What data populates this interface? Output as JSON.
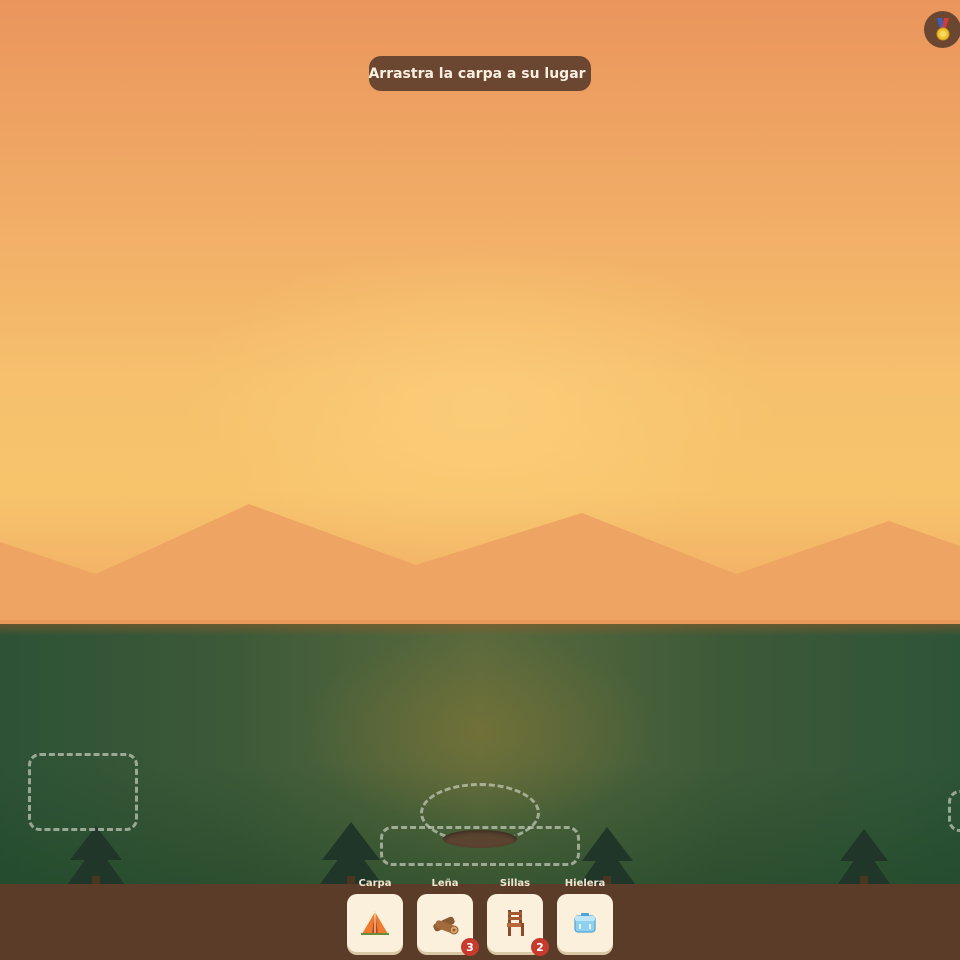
{
  "hint": {
    "text": "Arrastra la carpa a su lugar"
  },
  "hint_icon": "tent-icon",
  "medal_icon": "medal-icon",
  "colors": {
    "sky_top": "#ea955c",
    "sky_mid": "#f7c46c",
    "mountains": "#eea563",
    "ground": "#3d5a38",
    "tree": "#1f3628",
    "tray": "#5a3c28",
    "card": "#fbf0dc",
    "badge": "#c73a2e",
    "hint_bg": "#6b4731"
  },
  "inventory": [
    {
      "label": "Carpa",
      "icon": "tent-icon",
      "count": ""
    },
    {
      "label": "Leña",
      "icon": "firewood-icon",
      "count": "3"
    },
    {
      "label": "Sillas",
      "icon": "chair-icon",
      "count": "2"
    },
    {
      "label": "Hielera",
      "icon": "cooler-icon",
      "count": ""
    }
  ]
}
